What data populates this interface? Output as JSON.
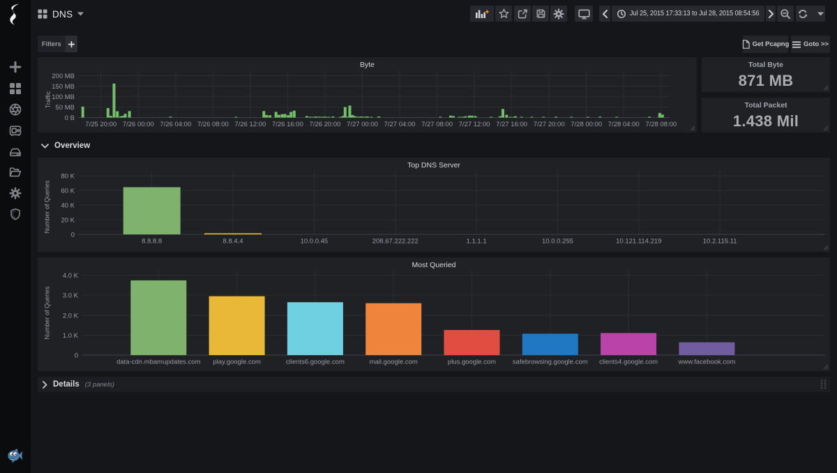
{
  "colors": {
    "page_bg": "#151619",
    "sidebar_bg": "#0b0c0e",
    "panel_bg": "#1f2125",
    "grid_line": "#2b2d31",
    "axis_line": "#3f4146",
    "accent_orange": "#f6932a",
    "byte_bar_green": "#73bf69",
    "palette": [
      "#7eb26d",
      "#eab839",
      "#6ed0e0",
      "#ef843c",
      "#e24d42",
      "#1f78c1",
      "#ba43a9",
      "#705da0"
    ],
    "fish_blue": "#4e81ad"
  },
  "sidebar": {
    "logo": "grafana-swirl-logo",
    "items": [
      {
        "icon": "plus-icon"
      },
      {
        "icon": "dashboards-grid-icon"
      },
      {
        "icon": "aperture-icon"
      },
      {
        "icon": "vault-icon"
      },
      {
        "icon": "harddrive-icon"
      },
      {
        "icon": "folder-open-icon"
      },
      {
        "icon": "gear-icon"
      },
      {
        "icon": "shield-icon"
      }
    ],
    "bottom_icon": "fish-icon"
  },
  "navbar": {
    "dashboard_title": "DNS",
    "time_range": "Jul 25, 2015 17:33:13 to Jul 28, 2015 08:54:56",
    "icons": [
      "add-panel-icon",
      "star-icon",
      "share-icon",
      "save-icon",
      "gear-icon",
      "monitor-icon",
      "chevron-left-icon",
      "clock-icon",
      "chevron-right-icon",
      "zoom-out-icon",
      "refresh-icon",
      "caret-down-icon"
    ]
  },
  "submenu": {
    "filters_label": "Filters",
    "filters_add": "+",
    "get_pcapng_label": "Get Pcapng",
    "goto_label": "Goto >>"
  },
  "rows": {
    "overview_label": "Overview",
    "details_label": "Details",
    "details_count": "(3 panels)"
  },
  "stats": [
    {
      "title": "Total Byte",
      "value": "871 MB"
    },
    {
      "title": "Total Packet",
      "value": "1.438 Mil"
    }
  ],
  "chart_data": [
    {
      "type": "bar",
      "title": "Byte",
      "ylabel": "Traffic",
      "xlabel": "",
      "time_start": "Jul 25, 2015 17:33:13",
      "time_end": "Jul 28, 2015 08:54:56",
      "duration_hours": 63.36,
      "y_unit": "MB",
      "ylim": [
        0,
        215
      ],
      "bar_color": "#73bf69",
      "yticks": [
        {
          "v": 0,
          "label": "0 B"
        },
        {
          "v": 50,
          "label": "50 MB"
        },
        {
          "v": 100,
          "label": "100 MB"
        },
        {
          "v": 150,
          "label": "150 MB"
        },
        {
          "v": 200,
          "label": "200 MB"
        }
      ],
      "xticks": [
        {
          "t": 2.446,
          "label": "7/25 20:00"
        },
        {
          "t": 6.446,
          "label": "7/26 00:00"
        },
        {
          "t": 10.446,
          "label": "7/26 04:00"
        },
        {
          "t": 14.446,
          "label": "7/26 08:00"
        },
        {
          "t": 18.446,
          "label": "7/26 12:00"
        },
        {
          "t": 22.446,
          "label": "7/26 16:00"
        },
        {
          "t": 26.446,
          "label": "7/26 20:00"
        },
        {
          "t": 30.446,
          "label": "7/27 00:00"
        },
        {
          "t": 34.446,
          "label": "7/27 04:00"
        },
        {
          "t": 38.446,
          "label": "7/27 08:00"
        },
        {
          "t": 42.446,
          "label": "7/27 12:00"
        },
        {
          "t": 46.446,
          "label": "7/27 16:00"
        },
        {
          "t": 50.446,
          "label": "7/27 20:00"
        },
        {
          "t": 54.446,
          "label": "7/28 00:00"
        },
        {
          "t": 58.446,
          "label": "7/28 04:00"
        },
        {
          "t": 62.446,
          "label": "7/28 08:00"
        }
      ],
      "bars": [
        [
          0.5,
          52
        ],
        [
          3.2,
          45
        ],
        [
          3.5,
          8
        ],
        [
          3.85,
          162
        ],
        [
          4.2,
          30
        ],
        [
          4.55,
          6
        ],
        [
          4.8,
          8
        ],
        [
          5.05,
          18
        ],
        [
          5.5,
          31
        ],
        [
          9.9,
          4
        ],
        [
          16.9,
          3
        ],
        [
          19.9,
          31
        ],
        [
          20.2,
          12
        ],
        [
          20.55,
          11
        ],
        [
          21.2,
          27
        ],
        [
          21.5,
          13
        ],
        [
          21.85,
          16
        ],
        [
          22.15,
          17
        ],
        [
          22.5,
          11
        ],
        [
          22.8,
          27
        ],
        [
          23.15,
          33
        ],
        [
          24.5,
          7
        ],
        [
          24.85,
          4
        ],
        [
          25.2,
          3
        ],
        [
          25.5,
          5
        ],
        [
          25.85,
          4
        ],
        [
          26.2,
          4
        ],
        [
          26.5,
          4
        ],
        [
          26.85,
          3
        ],
        [
          27.3,
          5
        ],
        [
          28.1,
          3
        ],
        [
          28.4,
          8
        ],
        [
          28.6,
          50
        ],
        [
          28.9,
          4
        ],
        [
          29.1,
          57
        ],
        [
          29.4,
          12
        ],
        [
          29.7,
          6
        ],
        [
          30.05,
          4
        ],
        [
          30.35,
          5
        ],
        [
          30.7,
          4
        ],
        [
          31.0,
          5
        ],
        [
          31.4,
          3
        ],
        [
          32.2,
          5
        ],
        [
          38.8,
          2
        ],
        [
          39.9,
          9
        ],
        [
          40.2,
          7
        ],
        [
          40.85,
          2
        ],
        [
          41.2,
          2
        ],
        [
          41.5,
          6
        ],
        [
          41.9,
          9
        ],
        [
          42.2,
          9
        ],
        [
          42.55,
          7
        ],
        [
          44.25,
          3
        ],
        [
          45.2,
          6
        ],
        [
          45.5,
          41
        ],
        [
          45.9,
          13
        ],
        [
          46.3,
          2
        ],
        [
          46.7,
          2
        ],
        [
          46.85,
          6
        ],
        [
          47.5,
          2
        ],
        [
          48.6,
          3
        ],
        [
          49.85,
          2
        ],
        [
          51.2,
          4
        ],
        [
          52.85,
          2
        ],
        [
          54.6,
          3
        ],
        [
          55.9,
          4
        ],
        [
          57.7,
          2
        ],
        [
          61.2,
          4
        ],
        [
          62.3,
          22
        ],
        [
          62.6,
          14
        ]
      ]
    },
    {
      "type": "bar",
      "title": "Top DNS Server",
      "ylabel": "Number of Queries",
      "xlabel": "",
      "categories": [
        "8.8.8.8",
        "8.8.4.4",
        "10.0.0.45",
        "208.67.222.222",
        "1.1.1.1",
        "10.0.0.255",
        "10.121.114.219",
        "10.2.115.11"
      ],
      "values": [
        64500,
        1500,
        0,
        0,
        0,
        0,
        0,
        0
      ],
      "colors": [
        "#7eb26d",
        "#eab839",
        "#6ed0e0",
        "#ef843c",
        "#e24d42",
        "#1f78c1",
        "#ba43a9",
        "#705da0"
      ],
      "ylim": [
        0,
        88000
      ],
      "yticks": [
        {
          "v": 0,
          "label": "0"
        },
        {
          "v": 20000,
          "label": "20 K"
        },
        {
          "v": 40000,
          "label": "40 K"
        },
        {
          "v": 60000,
          "label": "60 K"
        },
        {
          "v": 80000,
          "label": "80 K"
        }
      ]
    },
    {
      "type": "bar",
      "title": "Most Queried",
      "ylabel": "Number of Queries",
      "xlabel": "",
      "categories": [
        "data-cdn.mbamupdates.com",
        "play.google.com",
        "clients6.google.com",
        "mail.google.com",
        "plus.google.com",
        "safebrowsing.google.com",
        "clients4.google.com",
        "www.facebook.com"
      ],
      "values": [
        3745,
        2950,
        2650,
        2600,
        1260,
        1075,
        1105,
        640
      ],
      "colors": [
        "#7eb26d",
        "#eab839",
        "#6ed0e0",
        "#ef843c",
        "#e24d42",
        "#1f78c1",
        "#ba43a9",
        "#705da0"
      ],
      "ylim": [
        0,
        4400
      ],
      "yticks": [
        {
          "v": 0,
          "label": "0"
        },
        {
          "v": 1000,
          "label": "1.0 K"
        },
        {
          "v": 2000,
          "label": "2.0 K"
        },
        {
          "v": 3000,
          "label": "3.0 K"
        },
        {
          "v": 4000,
          "label": "4.0 K"
        }
      ]
    }
  ]
}
